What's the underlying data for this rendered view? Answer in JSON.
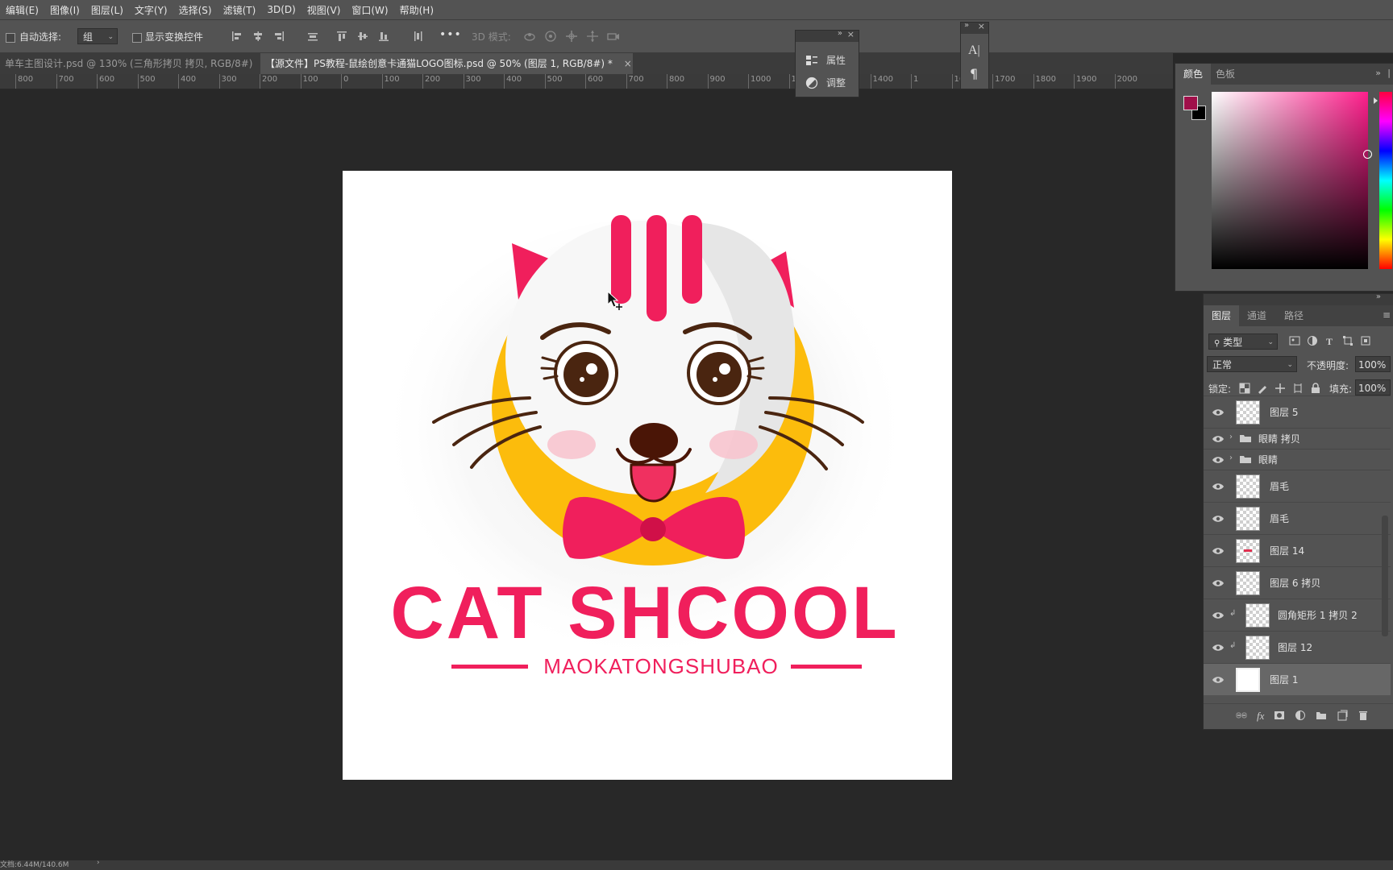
{
  "menu": [
    "编辑(E)",
    "图像(I)",
    "图层(L)",
    "文字(Y)",
    "选择(S)",
    "滤镜(T)",
    "3D(D)",
    "视图(V)",
    "窗口(W)",
    "帮助(H)"
  ],
  "options": {
    "auto_select_label": "自动选择:",
    "auto_select_value": "组",
    "show_transform_label": "显示变换控件",
    "more_label": "•••",
    "mode_3d_label": "3D 模式:"
  },
  "tabs": [
    {
      "label": "单车主图设计.psd @ 130% (三角形拷贝 拷贝, RGB/8#)",
      "close": "×"
    },
    {
      "label": "【源文件】PS教程-鼠绘创意卡通猫LOGO图标.psd @ 50% (图层 1, RGB/8#) *",
      "close": "×"
    }
  ],
  "ruler": [
    "800",
    "700",
    "600",
    "500",
    "400",
    "300",
    "200",
    "100",
    "0",
    "100",
    "200",
    "300",
    "400",
    "500",
    "600",
    "700",
    "800",
    "900",
    "1000",
    "1",
    "1300",
    "1400",
    "1",
    "1600",
    "1700",
    "1800",
    "1900",
    "2000"
  ],
  "float_panel": {
    "items": [
      {
        "label": "属性"
      },
      {
        "label": "调整"
      }
    ]
  },
  "color_panel": {
    "tabs": [
      "颜色",
      "色板"
    ],
    "foreground": "#a0104a",
    "background": "#000000",
    "picker_hue": "#ff1f8c"
  },
  "layers_panel": {
    "tabs": [
      "图层",
      "通道",
      "路径"
    ],
    "filter_label": "类型",
    "blend_mode": "正常",
    "opacity_label": "不透明度:",
    "opacity_value": "100%",
    "lock_label": "锁定:",
    "fill_label": "填充:",
    "fill_value": "100%",
    "layers": [
      {
        "name": "图层 5",
        "type": "layer"
      },
      {
        "name": "眼睛 拷贝",
        "type": "group"
      },
      {
        "name": "眼睛",
        "type": "group"
      },
      {
        "name": "眉毛",
        "type": "layer"
      },
      {
        "name": "眉毛",
        "type": "layer"
      },
      {
        "name": "图层 14",
        "type": "layer"
      },
      {
        "name": "图层 6 拷贝",
        "type": "layer"
      },
      {
        "name": "圆角矩形 1 拷贝 2",
        "type": "layer",
        "clipped": true
      },
      {
        "name": "图层 12",
        "type": "layer",
        "clipped": true
      },
      {
        "name": "图层 1",
        "type": "layer",
        "selected": true
      }
    ]
  },
  "logo": {
    "title": "CAT SHCOOL",
    "subtitle": "MAOKATONGSHUBAO",
    "pink": "#f01f5c",
    "yellow": "#fcbc0c"
  },
  "status": {
    "doc_size": "文档:6.44M/140.6M"
  }
}
